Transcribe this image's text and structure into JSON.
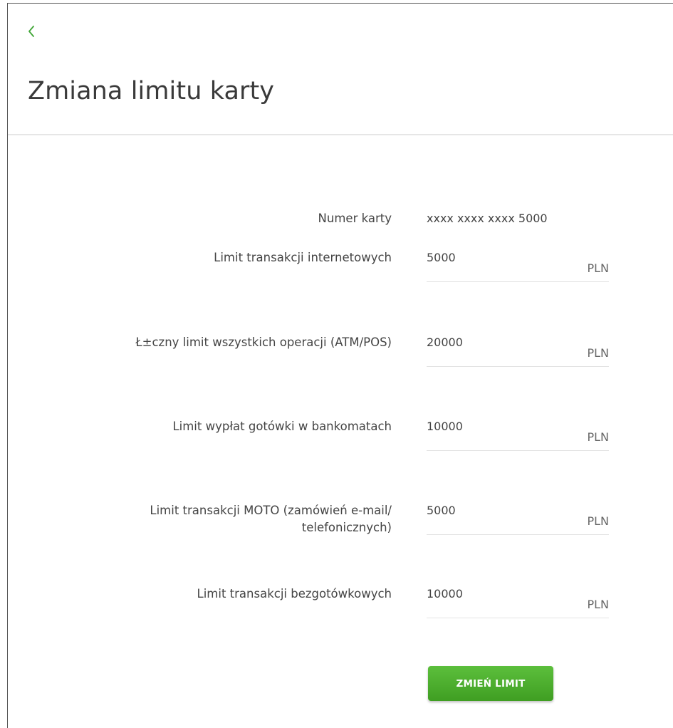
{
  "header": {
    "title": "Zmiana limitu karty",
    "back_icon": "chevron-left-icon",
    "accent_color": "#3fa535"
  },
  "form": {
    "card_number": {
      "label": "Numer karty",
      "value": "xxxx xxxx xxxx 5000"
    },
    "fields": [
      {
        "label": "Limit transakcji internetowych",
        "value": "5000",
        "currency": "PLN"
      },
      {
        "label": "Ł±czny limit wszystkich operacji (ATM/POS)",
        "value": "20000",
        "currency": "PLN"
      },
      {
        "label": "Limit wypłat gotówki w bankomatach",
        "value": "10000",
        "currency": "PLN"
      },
      {
        "label": "Limit transakcji MOTO (zamówień e-mail/",
        "label_line2": "telefonicznych)",
        "value": "5000",
        "currency": "PLN"
      },
      {
        "label": "Limit transakcji bezgotówkowych",
        "value": "10000",
        "currency": "PLN"
      }
    ],
    "submit_label": "ZMIEŃ LIMIT",
    "button_color": "#4caf30"
  }
}
